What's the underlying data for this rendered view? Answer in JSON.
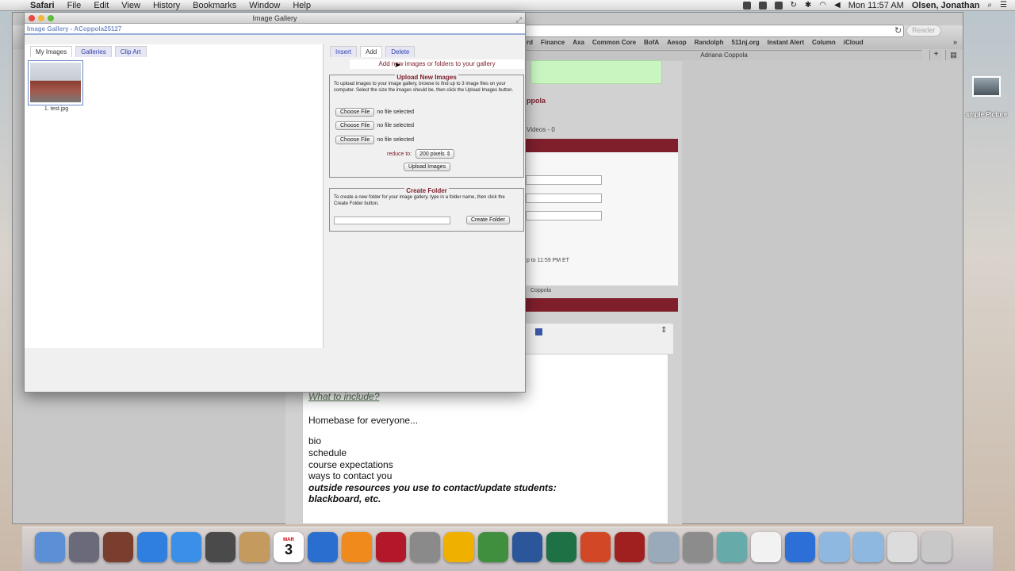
{
  "menubar": {
    "app": "Safari",
    "items": [
      "File",
      "Edit",
      "View",
      "History",
      "Bookmarks",
      "Window",
      "Help"
    ],
    "clock": "Mon 11:57 AM",
    "user": "Olsen, Jonathan"
  },
  "safari": {
    "reader_label": "Reader",
    "bookmarks": [
      "rd",
      "Finance",
      "Axa",
      "Common Core",
      "BofA",
      "Aesop",
      "Randolph",
      "511nj.org",
      "Instant Alert",
      "Column",
      "iCloud"
    ],
    "tab_title": "Adriana Coppola",
    "page": {
      "name_fragment": "ppola",
      "videos_tab": "Videos - 0",
      "deadline_fragment": "p to 11:59 PM ET",
      "author_fragment": "Coppola",
      "editor_link": "What to include?",
      "editor_lines": [
        "Homebase for everyone...",
        "bio",
        "schedule",
        "course expectations",
        "ways to contact you",
        "outside resources you use to contact/update students:",
        "blackboard, etc."
      ]
    }
  },
  "desktop": {
    "icon_label": "ample Picture"
  },
  "gallery": {
    "title": "Image Gallery",
    "subhead": "Image Gallery - ACoppola25127",
    "left_tabs": [
      "My Images",
      "Galleries",
      "Clip Art"
    ],
    "right_tabs": [
      "Insert",
      "Add",
      "Delete"
    ],
    "hint": "Add new images or folders to your gallery",
    "images": [
      {
        "label": "1. test.jpg"
      }
    ],
    "upload": {
      "legend": "Upload New Images",
      "description": "To upload images to your image gallery, browse to find up to 3 image files on your computer. Select the size the images should be, then click the Upload Images button.",
      "choose_label": "Choose File",
      "no_file": "no file selected",
      "reduce_label": "reduce to:",
      "size_option": "200 pixels",
      "upload_label": "Upload Images"
    },
    "folder": {
      "legend": "Create Folder",
      "description": "To create a new folder for your image gallery, type in a folder name, then click the Create Folder button.",
      "input_value": "",
      "create_label": "Create Folder"
    }
  },
  "dock": {
    "icons": [
      "finder-icon",
      "launchpad-icon",
      "photo-booth-icon",
      "app-store-icon",
      "safari-icon",
      "facetime-icon",
      "contacts-icon",
      "calendar-icon",
      "itunes-icon",
      "ibooks-icon",
      "photo-slideshow-icon",
      "system-preferences-icon",
      "outlook-icon",
      "iphoto-icon",
      "word-icon",
      "excel-icon",
      "powerpoint-icon",
      "dictionary-icon",
      "preview-icon",
      "utilities-icon",
      "image-capture-icon",
      "reminders-icon",
      "quicktime-icon",
      "folder-icon",
      "folder-icon",
      "documents-stack-icon",
      "trash-icon"
    ],
    "calendar_day": "3",
    "calendar_month": "MAR"
  }
}
